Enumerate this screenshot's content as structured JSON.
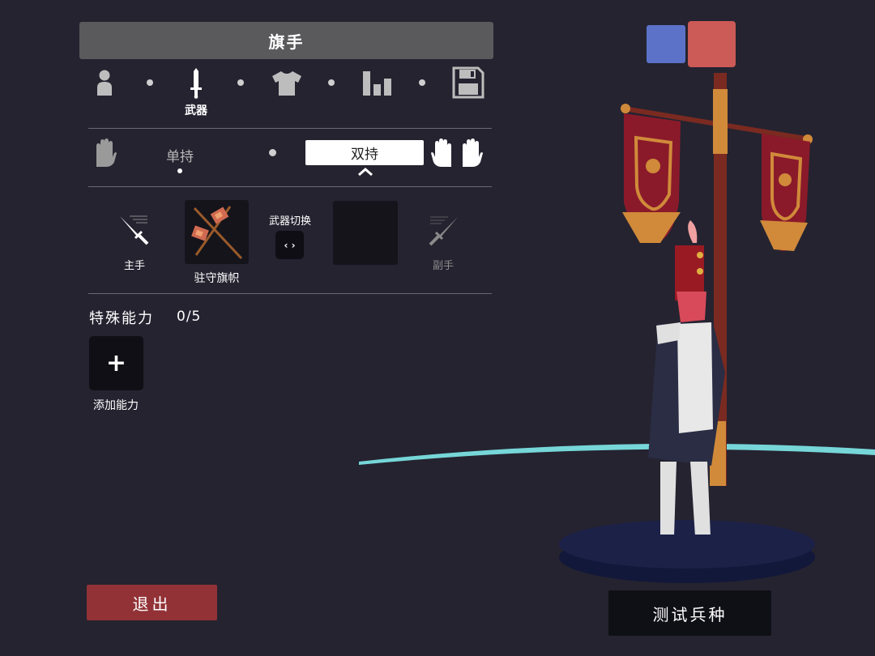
{
  "editor": {
    "title": "旗手",
    "category_tabs": [
      {
        "icon": "person-icon",
        "active": false
      },
      {
        "icon": "sword-icon",
        "label": "武器",
        "active": true
      },
      {
        "icon": "shirt-icon",
        "active": false
      },
      {
        "icon": "bar-chart-icon",
        "active": false
      },
      {
        "icon": "save-icon",
        "active": false
      }
    ],
    "grip": {
      "single_label": "单持",
      "dual_label": "双持",
      "selected": "dual"
    },
    "weapons": {
      "main_hand_label": "主手",
      "main_weapon_name": "驻守旗帜",
      "swap_label": "武器切换",
      "swap_button": "‹ ›",
      "off_hand_label": "副手"
    },
    "abilities": {
      "title": "特殊能力",
      "count": "0/5",
      "add_symbol": "+",
      "add_label": "添加能力"
    },
    "exit_label": "退出"
  },
  "preview": {
    "team_colors": [
      "#5b72c8",
      "#cc5a56"
    ],
    "test_label": "测试兵种"
  },
  "colors": {
    "background": "#252330",
    "accent_red": "#923237",
    "ground_ring": "#76d6d8"
  }
}
